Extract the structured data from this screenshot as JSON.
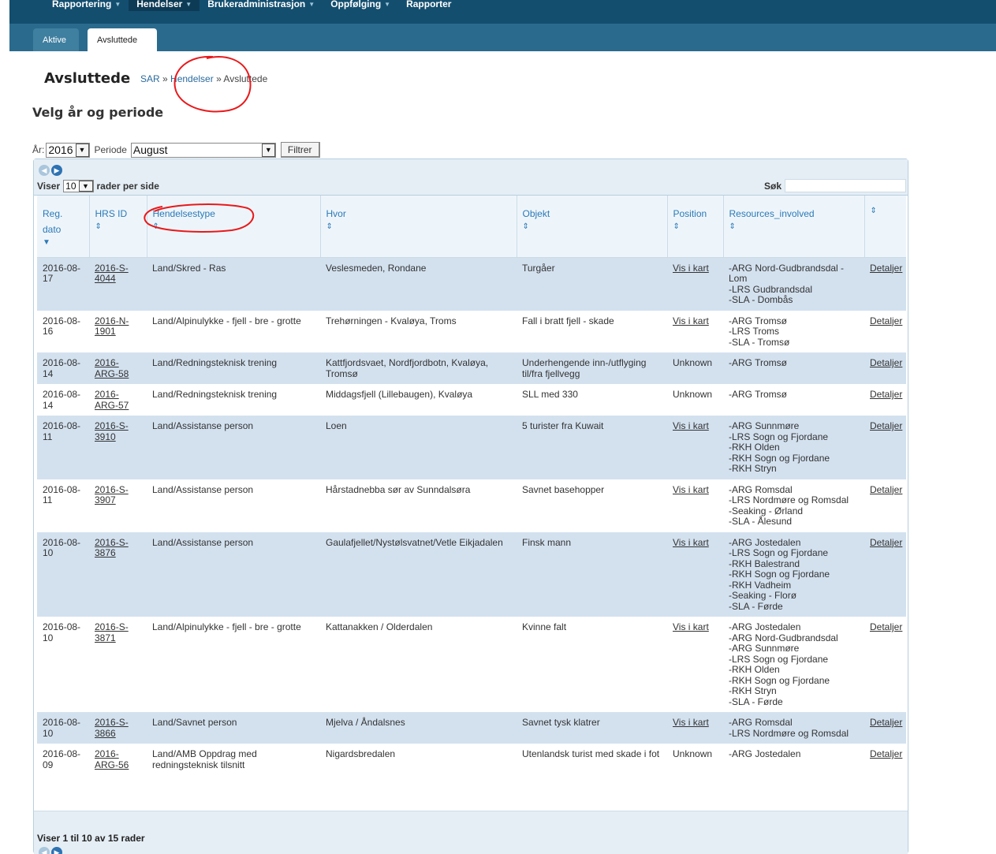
{
  "topnav": {
    "items": [
      {
        "label": "Rapportering"
      },
      {
        "label": "Hendelser"
      },
      {
        "label": "Brukeradministrasjon"
      },
      {
        "label": "Oppfølging"
      },
      {
        "label": "Rapporter"
      }
    ]
  },
  "subnav": {
    "tabs": [
      {
        "label": "Aktive"
      },
      {
        "label": "Avsluttede"
      }
    ]
  },
  "page": {
    "title": "Avsluttede",
    "breadcrumb": {
      "root": "SAR",
      "sep1": " » ",
      "parent": "Hendelser",
      "sep2": " » ",
      "current": "Avsluttede"
    },
    "section_heading": "Velg år og periode"
  },
  "filter": {
    "year_label": "År:",
    "year_value": "2016",
    "period_label": "Periode",
    "period_value": "August",
    "button_label": "Filtrer"
  },
  "table_controls": {
    "show_label": "Viser",
    "page_length": "10",
    "rows_per_page_label": "rader per side",
    "search_label": "Søk",
    "search_value": ""
  },
  "columns": [
    {
      "label": "Reg. dato"
    },
    {
      "label": "HRS ID"
    },
    {
      "label": "Hendelsestype"
    },
    {
      "label": "Hvor"
    },
    {
      "label": "Objekt"
    },
    {
      "label": "Position"
    },
    {
      "label": "Resources_involved"
    },
    {
      "label": ""
    }
  ],
  "rows": [
    {
      "date": "2016-08-17",
      "hrs_id": "2016-S-4044",
      "type": "Land/Skred - Ras",
      "where": "Veslesmeden, Rondane",
      "object": "Turgåer",
      "position": "Vis i kart",
      "resources": [
        "-ARG Nord-Gudbrandsdal - Lom",
        "-LRS Gudbrandsdal",
        "-SLA - Dombås"
      ],
      "details": "Detaljer"
    },
    {
      "date": "2016-08-16",
      "hrs_id": "2016-N-1901",
      "type": "Land/Alpinulykke - fjell - bre - grotte",
      "where": "Trehørningen - Kvaløya, Troms",
      "object": "Fall i bratt fjell - skade",
      "position": "Vis i kart",
      "resources": [
        "-ARG Tromsø",
        "-LRS Troms",
        "-SLA - Tromsø"
      ],
      "details": "Detaljer"
    },
    {
      "date": "2016-08-14",
      "hrs_id": "2016-ARG-58",
      "type": "Land/Redningsteknisk trening",
      "where": "Kattfjordsvaet, Nordfjordbotn, Kvaløya, Tromsø",
      "object": "Underhengende inn-/utflyging til/fra fjellvegg",
      "position": "Unknown",
      "resources": [
        "-ARG Tromsø"
      ],
      "details": "Detaljer"
    },
    {
      "date": "2016-08-14",
      "hrs_id": "2016-ARG-57",
      "type": "Land/Redningsteknisk trening",
      "where": "Middagsfjell (Lillebaugen), Kvaløya",
      "object": "SLL med 330",
      "position": "Unknown",
      "resources": [
        "-ARG Tromsø"
      ],
      "details": "Detaljer"
    },
    {
      "date": "2016-08-11",
      "hrs_id": "2016-S-3910",
      "type": "Land/Assistanse person",
      "where": "Loen",
      "object": "5 turister fra Kuwait",
      "position": "Vis i kart",
      "resources": [
        "-ARG Sunnmøre",
        "-LRS Sogn og Fjordane",
        "-RKH Olden",
        "-RKH Sogn og Fjordane",
        "-RKH Stryn"
      ],
      "details": "Detaljer"
    },
    {
      "date": "2016-08-11",
      "hrs_id": "2016-S-3907",
      "type": "Land/Assistanse person",
      "where": "Hårstadnebba sør av Sunndalsøra",
      "object": "Savnet basehopper",
      "position": "Vis i kart",
      "resources": [
        "-ARG Romsdal",
        "-LRS Nordmøre og Romsdal",
        "-Seaking - Ørland",
        "-SLA - Ålesund"
      ],
      "details": "Detaljer"
    },
    {
      "date": "2016-08-10",
      "hrs_id": "2016-S-3876",
      "type": "Land/Assistanse person",
      "where": "Gaulafjellet/Nystølsvatnet/Vetle Eikjadalen",
      "object": "Finsk mann",
      "position": "Vis i kart",
      "resources": [
        "-ARG Jostedalen",
        "-LRS Sogn og Fjordane",
        "-RKH Balestrand",
        "-RKH Sogn og Fjordane",
        "-RKH Vadheim",
        "-Seaking - Florø",
        "-SLA - Førde"
      ],
      "details": "Detaljer"
    },
    {
      "date": "2016-08-10",
      "hrs_id": "2016-S-3871",
      "type": "Land/Alpinulykke - fjell - bre - grotte",
      "where": "Kattanakken / Olderdalen",
      "object": "Kvinne falt",
      "position": "Vis i kart",
      "resources": [
        "-ARG Jostedalen",
        "-ARG Nord-Gudbrandsdal",
        "-ARG Sunnmøre",
        "-LRS Sogn og Fjordane",
        "-RKH Olden",
        "-RKH Sogn og Fjordane",
        "-RKH Stryn",
        "-SLA - Førde"
      ],
      "details": "Detaljer"
    },
    {
      "date": "2016-08-10",
      "hrs_id": "2016-S-3866",
      "type": "Land/Savnet person",
      "where": "Mjelva / Åndalsnes",
      "object": "Savnet tysk klatrer",
      "position": "Vis i kart",
      "resources": [
        "-ARG Romsdal",
        "-LRS Nordmøre og Romsdal"
      ],
      "details": "Detaljer"
    },
    {
      "date": "2016-08-09",
      "hrs_id": "2016-ARG-56",
      "type": "Land/AMB Oppdrag med redningsteknisk tilsnitt",
      "where": "Nigardsbredalen",
      "object": "Utenlandsk turist med skade i fot",
      "position": "Unknown",
      "resources": [
        "-ARG Jostedalen"
      ],
      "details": "Detaljer"
    }
  ],
  "footer": {
    "info": "Viser 1 til 10 av 15 rader"
  },
  "colors": {
    "nav_dark": "#134e6f",
    "subnav": "#2a6a8d",
    "row_odd": "#d3e1ef",
    "header_text": "#2a7ab8",
    "annotation_red": "#e8191b"
  }
}
